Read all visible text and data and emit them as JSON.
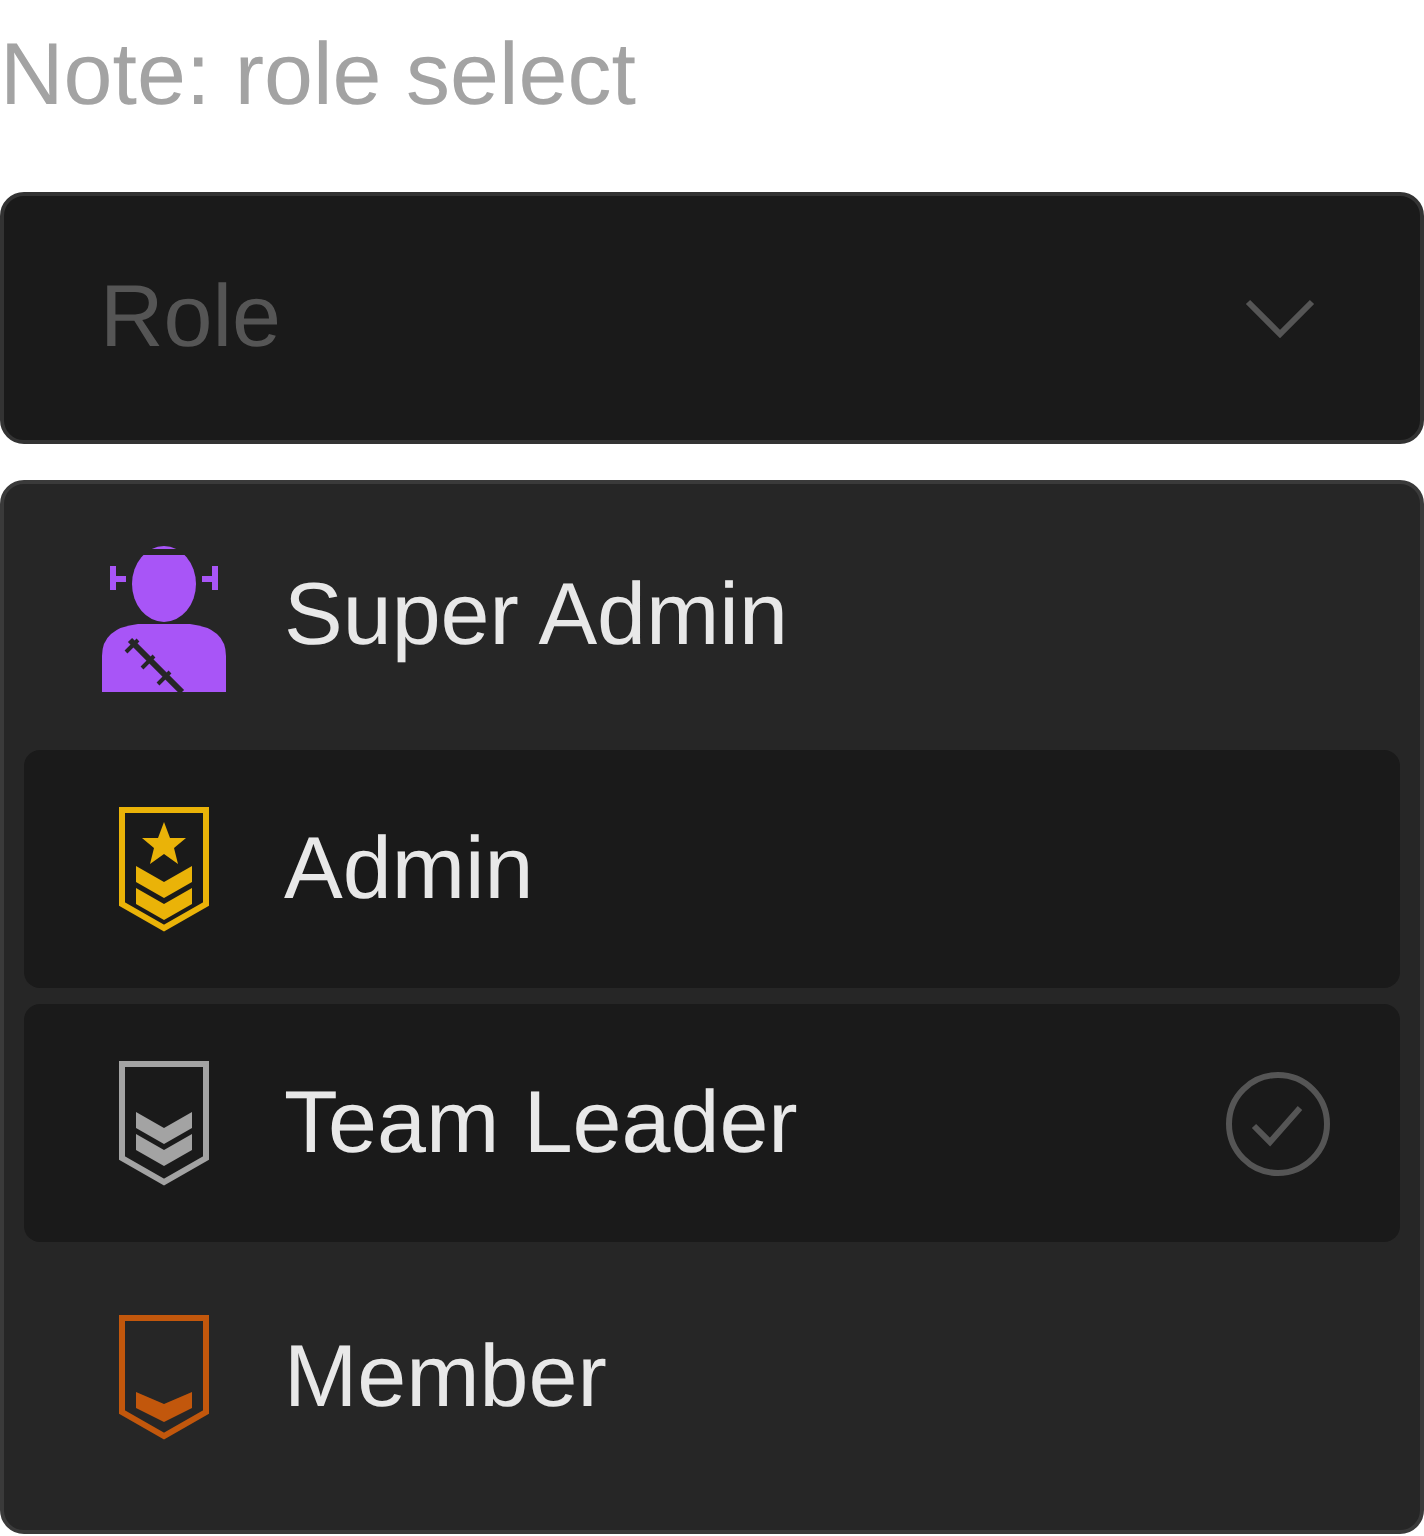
{
  "note": "Note: role select",
  "select": {
    "placeholder": "Role",
    "expanded": true
  },
  "options": [
    {
      "label": "Super Admin",
      "kind": "figure",
      "color": "#a855f7",
      "highlighted": false,
      "selected": false
    },
    {
      "label": "Admin",
      "kind": "badge-star",
      "color": "#eab308",
      "highlighted": true,
      "selected": false
    },
    {
      "label": "Team Leader",
      "kind": "badge-double",
      "color": "#a3a3a3",
      "highlighted": true,
      "selected": true
    },
    {
      "label": "Member",
      "kind": "badge-single",
      "color": "#c2570c",
      "highlighted": false,
      "selected": false
    }
  ]
}
